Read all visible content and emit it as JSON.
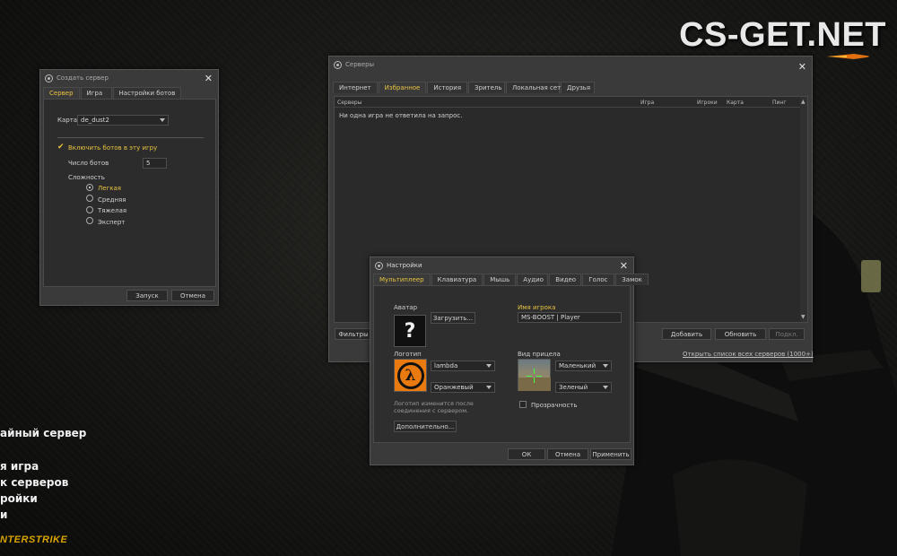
{
  "watermark": "CS-GET.NET",
  "main_menu": {
    "items": [
      "айный сервер",
      "я игра",
      "к серверов",
      "ройки",
      "и"
    ],
    "logo": "NTERSTRIKE"
  },
  "create_server": {
    "title": "Создать сервер",
    "tabs": [
      "Сервер",
      "Игра",
      "Настройки ботов"
    ],
    "map_label": "Карта",
    "map_value": "de_dust2",
    "bots_checkbox": "Включить ботов в эту игру",
    "bots_count_label": "Число ботов",
    "bots_count_value": "5",
    "difficulty_label": "Сложность",
    "difficulty_options": [
      "Легкая",
      "Средняя",
      "Тяжелая",
      "Эксперт"
    ],
    "difficulty_selected": "Легкая",
    "start_button": "Запуск",
    "cancel_button": "Отмена"
  },
  "servers": {
    "title": "Серверы",
    "tabs": [
      "Интернет",
      "Избранное",
      "История",
      "Зритель",
      "Локальная сеть",
      "Друзья"
    ],
    "active_tab": "Избранное",
    "columns": [
      "Серверы",
      "Игра",
      "Игроки",
      "Карта",
      "Пинг"
    ],
    "empty_message": "Ни одна игра не ответила на запрос.",
    "filters_button": "Фильтры",
    "add_button": "Добавить",
    "refresh_button": "Обновить",
    "connect_button": "Подкл.",
    "link_text": "Открыть список всех серверов (1000+)"
  },
  "settings": {
    "title": "Настройки",
    "tabs": [
      "Мультиплеер",
      "Клавиатура",
      "Мышь",
      "Аудио",
      "Видео",
      "Голос",
      "Замок"
    ],
    "avatar_label": "Аватар",
    "avatar_placeholder": "?",
    "upload_button": "Загрузить...",
    "player_name_label": "Имя игрока",
    "player_name_value": "MS-BOOST | Player",
    "logo_label": "Логотип",
    "logo_value": "lambda",
    "logo_color": "Оранжевый",
    "logo_note": "Логотип изменится после соединения с сервером.",
    "crosshair_label": "Вид прицела",
    "crosshair_size": "Маленький",
    "crosshair_color": "Зеленый",
    "transparency_label": "Прозрачность",
    "advanced_button": "Дополнительно...",
    "ok_button": "ОК",
    "cancel_button": "Отмена",
    "apply_button": "Применить"
  },
  "colors": {
    "accent": "#e8c340",
    "dialog_bg": "#3a3a3a",
    "lambda_orange": "#e87a10"
  }
}
